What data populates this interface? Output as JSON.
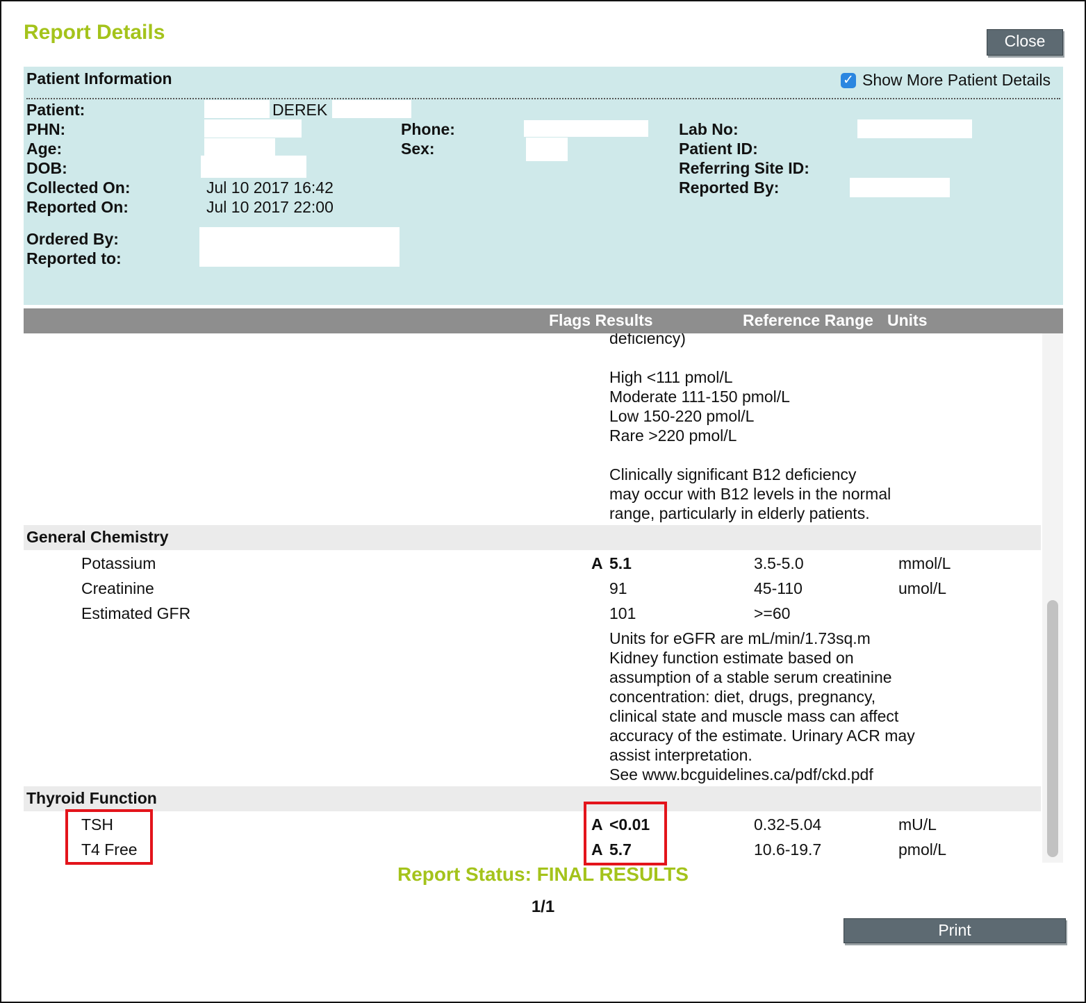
{
  "header": {
    "title": "Report Details",
    "close_label": "Close"
  },
  "patient_info": {
    "title": "Patient Information",
    "show_more_label": "Show More Patient Details",
    "show_more_checked": true,
    "labels": {
      "patient": "Patient:",
      "phn": "PHN:",
      "age": "Age:",
      "dob": "DOB:",
      "collected_on": "Collected On:",
      "reported_on": "Reported On:",
      "ordered_by": "Ordered By:",
      "reported_to": "Reported to:",
      "phone": "Phone:",
      "sex": "Sex:",
      "lab_no": "Lab No:",
      "patient_id": "Patient ID:",
      "referring_site_id": "Referring Site ID:",
      "reported_by": "Reported By:"
    },
    "values": {
      "patient_name": "DEREK",
      "collected_on": "Jul 10 2017 16:42",
      "reported_on": "Jul 10 2017 22:00"
    }
  },
  "grid_header": {
    "flags_results": "Flags Results",
    "reference_range": "Reference Range",
    "units": "Units"
  },
  "results": {
    "b12_comment": [
      "deficiency)",
      "",
      "High <111 pmol/L",
      "Moderate 111-150 pmol/L",
      "Low 150-220 pmol/L",
      "Rare >220 pmol/L",
      "",
      "Clinically significant B12 deficiency",
      "may occur with B12 levels in the normal",
      "range, particularly in elderly patients."
    ],
    "sections": {
      "general_chemistry": {
        "title": "General Chemistry",
        "rows": [
          {
            "test": "Potassium",
            "flag": "A",
            "result": "5.1",
            "range": "3.5-5.0",
            "units": "mmol/L"
          },
          {
            "test": "Creatinine",
            "flag": "",
            "result": "91",
            "range": "45-110",
            "units": "umol/L"
          },
          {
            "test": "Estimated GFR",
            "flag": "",
            "result": "101",
            "range": ">=60",
            "units": ""
          }
        ],
        "egfr_comment": [
          "Units for eGFR are mL/min/1.73sq.m",
          "Kidney function estimate based on",
          "assumption of a stable serum creatinine",
          "concentration: diet, drugs, pregnancy,",
          "clinical state and muscle mass can affect",
          "accuracy of the estimate. Urinary ACR may",
          "assist interpretation.",
          "See www.bcguidelines.ca/pdf/ckd.pdf"
        ]
      },
      "thyroid_function": {
        "title": "Thyroid Function",
        "rows": [
          {
            "test": "TSH",
            "flag": "A",
            "result": "<0.01",
            "range": "0.32-5.04",
            "units": "mU/L"
          },
          {
            "test": "T4 Free",
            "flag": "A",
            "result": "5.7",
            "range": "10.6-19.7",
            "units": "pmol/L"
          }
        ]
      }
    }
  },
  "footer": {
    "status": "Report Status: FINAL RESULTS",
    "page": "1/1",
    "print_label": "Print"
  },
  "colors": {
    "accent": "#a4c31b",
    "panel": "#cfe9ea",
    "button": "#5d6a72",
    "grid_header": "#8e8e8e",
    "highlight": "#e3141b"
  }
}
